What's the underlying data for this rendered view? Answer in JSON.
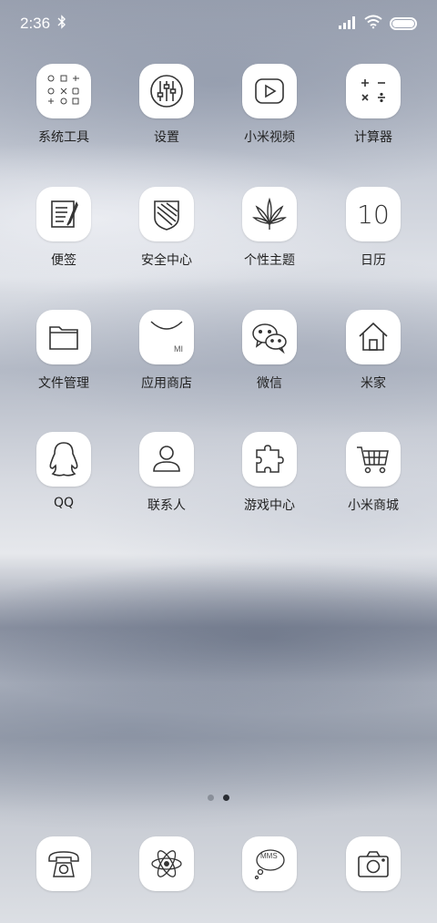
{
  "status_bar": {
    "time": "2:36",
    "bluetooth_icon": "bluetooth-icon",
    "signal_icon": "signal-icon",
    "wifi_icon": "wifi-icon",
    "battery_icon": "battery-icon",
    "battery_level": 1.0
  },
  "apps": [
    {
      "label": "系统工具",
      "icon": "folder-icon"
    },
    {
      "label": "设置",
      "icon": "sliders-icon"
    },
    {
      "label": "小米视频",
      "icon": "play-icon"
    },
    {
      "label": "计算器",
      "icon": "calculator-icon"
    },
    {
      "label": "便签",
      "icon": "notepad-icon"
    },
    {
      "label": "安全中心",
      "icon": "shield-icon"
    },
    {
      "label": "个性主题",
      "icon": "leaf-icon"
    },
    {
      "label": "日历",
      "icon": "calendar-icon",
      "number": "10"
    },
    {
      "label": "文件管理",
      "icon": "folder-file-icon"
    },
    {
      "label": "应用商店",
      "icon": "store-bag-icon",
      "badge": "MI"
    },
    {
      "label": "微信",
      "icon": "wechat-icon"
    },
    {
      "label": "米家",
      "icon": "home-icon"
    },
    {
      "label": "QQ",
      "icon": "penguin-icon"
    },
    {
      "label": "联系人",
      "icon": "contact-icon"
    },
    {
      "label": "游戏中心",
      "icon": "puzzle-icon"
    },
    {
      "label": "小米商城",
      "icon": "cart-icon"
    }
  ],
  "pager": {
    "pages": 2,
    "current": 2
  },
  "dock": [
    {
      "name": "phone",
      "icon": "phone-icon"
    },
    {
      "name": "browser",
      "icon": "atom-icon"
    },
    {
      "name": "messages",
      "icon": "mms-bubble-icon",
      "text": "MMS"
    },
    {
      "name": "camera",
      "icon": "camera-icon"
    }
  ]
}
